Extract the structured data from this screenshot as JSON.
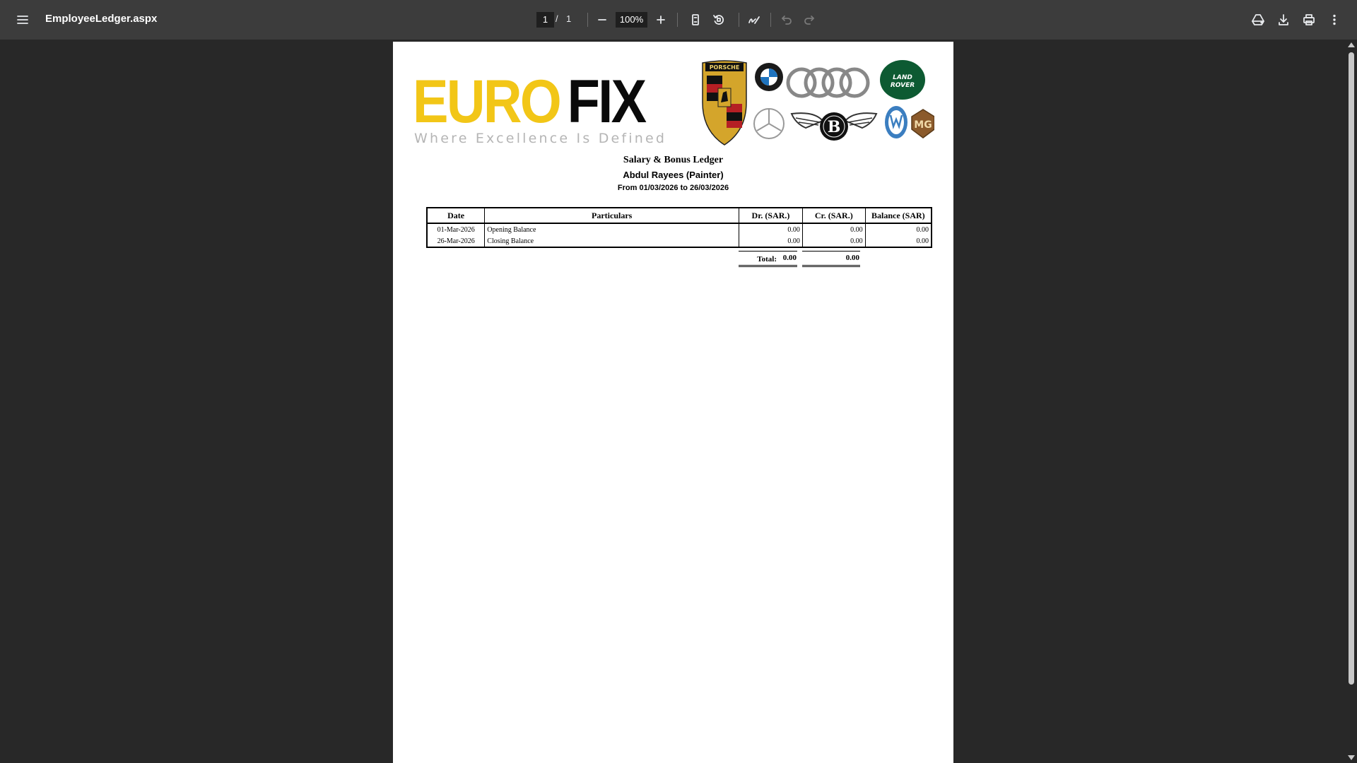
{
  "viewer": {
    "file_name": "EmployeeLedger.aspx",
    "current_page": "1",
    "page_separator": "/",
    "total_pages": "1",
    "zoom": "100%"
  },
  "logo": {
    "euro": "EURO",
    "fix": "FIX",
    "tagline": "Where Excellence Is Defined",
    "brand_marks": [
      "porsche-logo",
      "bmw-logo",
      "audi-logo",
      "land-rover-logo",
      "mercedes-logo",
      "bentley-logo",
      "volkswagen-logo",
      "mg-logo"
    ]
  },
  "report": {
    "title": "Salary & Bonus Ledger",
    "employee": "Abdul Rayees (Painter)",
    "period": "From 01/03/2026 to 26/03/2026"
  },
  "table": {
    "headers": [
      "Date",
      "Particulars",
      "Dr. (SAR.)",
      "Cr. (SAR.)",
      "Balance (SAR)"
    ],
    "rows": [
      [
        "01-Mar-2026",
        "Opening Balance",
        "0.00",
        "0.00",
        "0.00"
      ],
      [
        "26-Mar-2026",
        "Closing Balance",
        "0.00",
        "0.00",
        "0.00"
      ]
    ]
  },
  "totals": {
    "label": "Total:",
    "dr": "0.00",
    "cr": "0.00"
  }
}
